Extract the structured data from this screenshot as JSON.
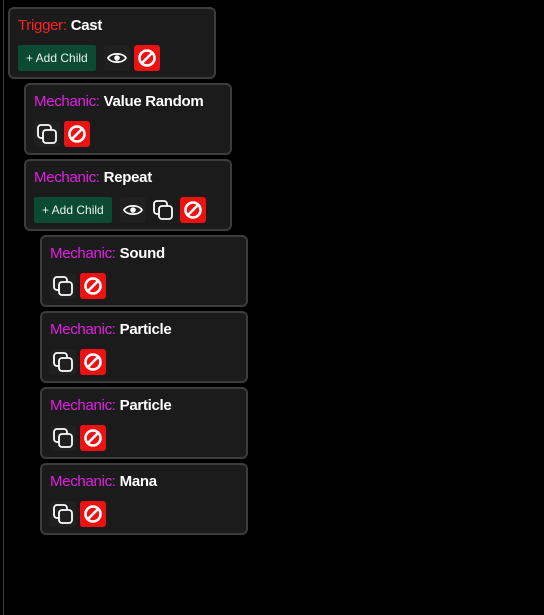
{
  "tree": {
    "add_child_label": "+ Add Child",
    "colors": {
      "trigger": "#ff2020",
      "mechanic": "#e21ee2",
      "add_child_bg": "#0d4a34",
      "delete_bg": "#ee1111"
    },
    "nodes": [
      {
        "kind": "Trigger:",
        "name": "Cast",
        "icons": [
          "eye-icon",
          "delete-icon"
        ],
        "has_add_child": true
      },
      {
        "kind": "Mechanic:",
        "name": "Value Random",
        "icons": [
          "copy-icon",
          "delete-icon"
        ],
        "has_add_child": false
      },
      {
        "kind": "Mechanic:",
        "name": "Repeat",
        "icons": [
          "eye-icon",
          "copy-icon",
          "delete-icon"
        ],
        "has_add_child": true
      },
      {
        "kind": "Mechanic:",
        "name": "Sound",
        "icons": [
          "copy-icon",
          "delete-icon"
        ],
        "has_add_child": false
      },
      {
        "kind": "Mechanic:",
        "name": "Particle",
        "icons": [
          "copy-icon",
          "delete-icon"
        ],
        "has_add_child": false
      },
      {
        "kind": "Mechanic:",
        "name": "Particle",
        "icons": [
          "copy-icon",
          "delete-icon"
        ],
        "has_add_child": false
      },
      {
        "kind": "Mechanic:",
        "name": "Mana",
        "icons": [
          "copy-icon",
          "delete-icon"
        ],
        "has_add_child": false
      }
    ]
  }
}
